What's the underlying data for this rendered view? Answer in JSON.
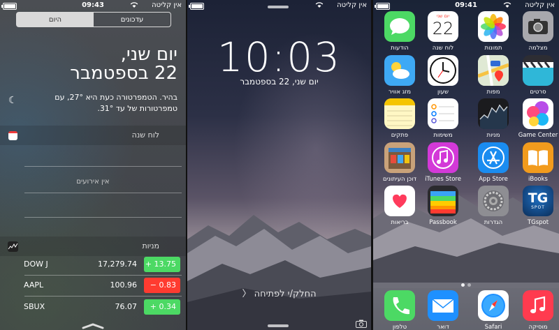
{
  "notification_center": {
    "status": {
      "time": "09:43",
      "carrier": "אין קליטה"
    },
    "tabs": {
      "today": "היום",
      "notifications": "עדכונים"
    },
    "date_line1": "יום שני,",
    "date_line2": "22 בספטמבר",
    "weather": "בהיר. הטמפרטורה כעת היא 27°, עם טמפרטורות של עד 31°.",
    "calendar": {
      "title": "לוח שנה",
      "no_events": "אין אירועים"
    },
    "stocks": {
      "title": "מניות",
      "items": [
        {
          "symbol": "DOW J",
          "price": "17,279.74",
          "change": "+ 13.75",
          "direction": "up"
        },
        {
          "symbol": "AAPL",
          "price": "100.96",
          "change": "− 0.83",
          "direction": "down"
        },
        {
          "symbol": "SBUX",
          "price": "76.07",
          "change": "+ 0.34",
          "direction": "up"
        }
      ]
    }
  },
  "lock_screen": {
    "status": {
      "carrier": "אין קליטה"
    },
    "clock": "10:03",
    "date": "יום שני, 22 בספטמבר",
    "slide_to_unlock": "החלק/י לפתיחה",
    "slide_arrow": "〈"
  },
  "home_screen": {
    "status": {
      "time": "09:41",
      "carrier": "אין קליטה"
    },
    "calendar_icon": {
      "day": "יום שני",
      "date": "22"
    },
    "apps": [
      {
        "name": "messages-app",
        "label": "הודעות",
        "icon": "messages-icon",
        "color": "#4cd964"
      },
      {
        "name": "calendar-app",
        "label": "לוח שנה",
        "icon": "calendar-icon",
        "color": "#ffffff"
      },
      {
        "name": "photos-app",
        "label": "תמונות",
        "icon": "photos-icon",
        "color": "#ffffff"
      },
      {
        "name": "camera-app",
        "label": "מצלמה",
        "icon": "camera-icon",
        "color": "#a8a8ad"
      },
      {
        "name": "weather-app",
        "label": "מזג אוויר",
        "icon": "weather-icon",
        "color": "#3ea9f5"
      },
      {
        "name": "clock-app",
        "label": "שעון",
        "icon": "clock-icon",
        "color": "#ffffff"
      },
      {
        "name": "maps-app",
        "label": "מפות",
        "icon": "maps-icon",
        "color": "#d9ead3"
      },
      {
        "name": "videos-app",
        "label": "סרטים",
        "icon": "videos-icon",
        "color": "#2d2d33"
      },
      {
        "name": "notes-app",
        "label": "פתקים",
        "icon": "notes-icon",
        "color": "#fff7c4"
      },
      {
        "name": "reminders-app",
        "label": "משימות",
        "icon": "reminders-icon",
        "color": "#ffffff"
      },
      {
        "name": "stocks-app",
        "label": "מניות",
        "icon": "stocks-icon",
        "color": "#1b1b1e"
      },
      {
        "name": "game-center-app",
        "label": "Game Center",
        "icon": "game-center-icon",
        "color": "#ffffff"
      },
      {
        "name": "newsstand-app",
        "label": "דוכן העיתונים",
        "icon": "newsstand-icon",
        "color": "#c9a27a"
      },
      {
        "name": "itunes-store-app",
        "label": "iTunes Store",
        "icon": "itunes-store-icon",
        "color": "#d339d8"
      },
      {
        "name": "app-store-app",
        "label": "App Store",
        "icon": "app-store-icon",
        "color": "#1a8cf0"
      },
      {
        "name": "ibooks-app",
        "label": "iBooks",
        "icon": "ibooks-icon",
        "color": "#f29b1d"
      },
      {
        "name": "health-app",
        "label": "בריאות",
        "icon": "health-icon",
        "color": "#ffffff"
      },
      {
        "name": "passbook-app",
        "label": "Passbook",
        "icon": "passbook-icon",
        "color": "#2a2a2e"
      },
      {
        "name": "settings-app",
        "label": "הגדרות",
        "icon": "settings-icon",
        "color": "#8e8e93"
      },
      {
        "name": "tgspot-app",
        "label": "TGspot",
        "icon": "tgspot-icon",
        "color": "#0b3a6e"
      }
    ],
    "tgspot_logo": {
      "big": "TG",
      "small": "SPOT"
    },
    "dock": [
      {
        "name": "phone-app",
        "label": "טלפון",
        "icon": "phone-icon",
        "color": "#4cd964"
      },
      {
        "name": "mail-app",
        "label": "דואר",
        "icon": "mail-icon",
        "color": "#1e90ff"
      },
      {
        "name": "safari-app",
        "label": "Safari",
        "icon": "safari-icon",
        "color": "#ffffff"
      },
      {
        "name": "music-app",
        "label": "מוסיקה",
        "icon": "music-icon",
        "color": "#ff3b4f"
      }
    ],
    "page_dots": {
      "count": 2,
      "current": 1
    }
  }
}
